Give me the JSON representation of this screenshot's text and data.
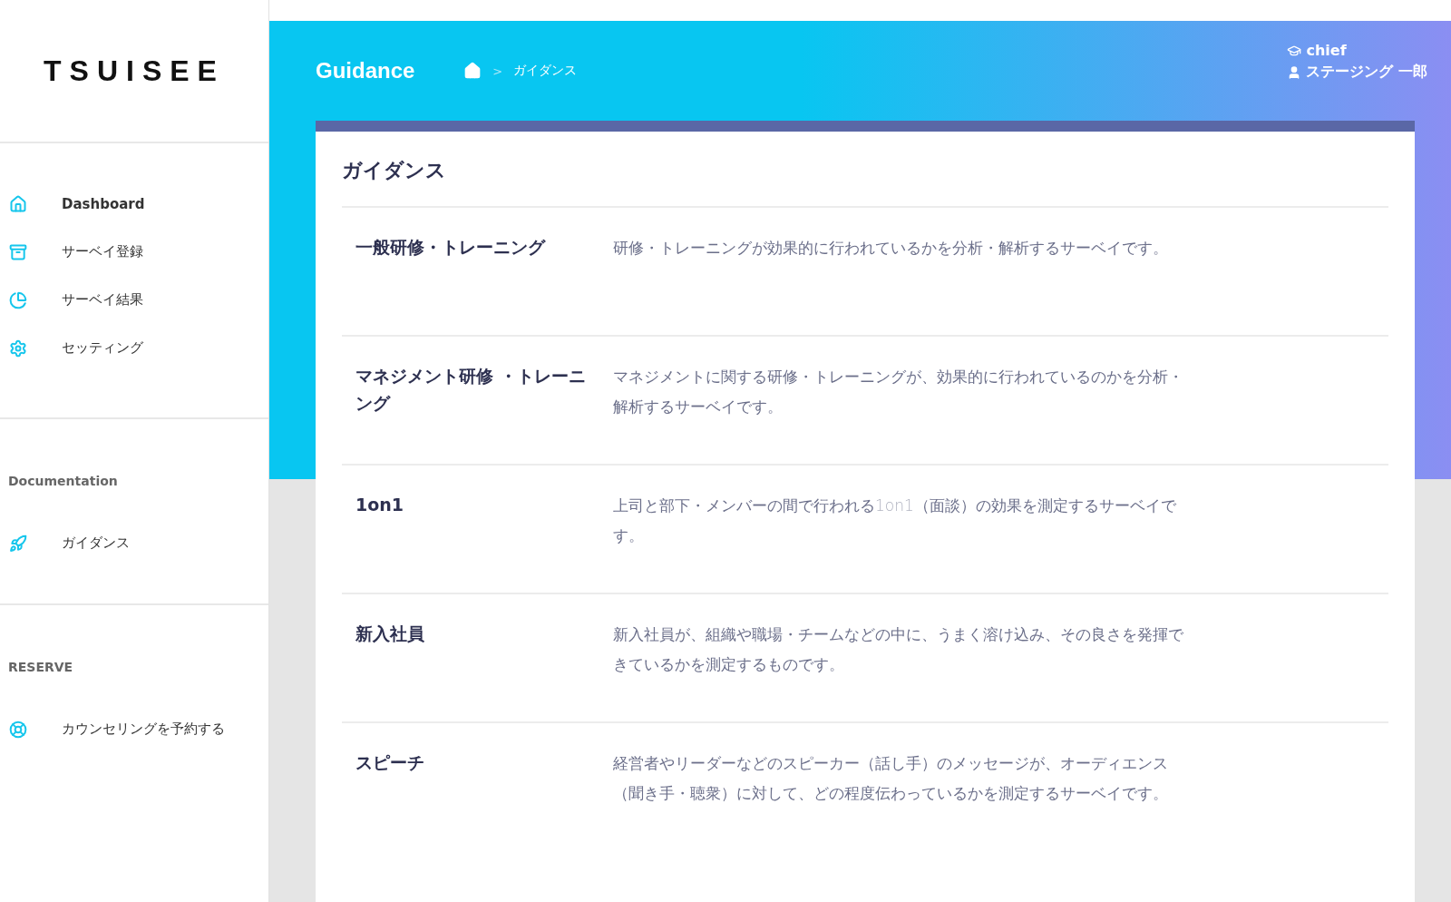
{
  "sidebar": {
    "logo": "TSUISEE",
    "sections": [
      {
        "items": [
          {
            "label": "Dashboard",
            "kind": "home",
            "selected": true
          },
          {
            "label": "サーベイ登録",
            "kind": "archive",
            "selected": false
          },
          {
            "label": "サーベイ結果",
            "kind": "chart",
            "selected": false
          },
          {
            "label": "セッティング",
            "kind": "settings",
            "selected": false
          }
        ]
      },
      {
        "heading": "Documentation",
        "items": [
          {
            "label": "ガイダンス",
            "kind": "rocket",
            "selected": false
          }
        ]
      },
      {
        "heading": "RESERVE",
        "items": [
          {
            "label": "カウンセリングを予約する",
            "kind": "support",
            "selected": false
          }
        ]
      }
    ]
  },
  "header": {
    "title": "Guidance",
    "breadcrumb": [
      {
        "kind": "home"
      },
      {
        "kind": "text",
        "label": "ガイダンス"
      }
    ],
    "separator": ">",
    "role": "chief",
    "user": "ステージング 一郎"
  },
  "card": {
    "title": "ガイダンス",
    "rows": [
      {
        "term": "一般研修・トレーニング",
        "description": [
          {
            "kind": "normal",
            "text": "研修・トレーニングが効果的に行われているかを分析・解析するサーベイです。"
          }
        ]
      },
      {
        "term": "マネジメント研修 ・トレーニング",
        "description": [
          {
            "kind": "normal",
            "text": "マネジメントに関する研修・トレーニングが、効果的に行われているのかを分析・解析するサーベイです。"
          }
        ]
      },
      {
        "term": "1on1",
        "description": [
          {
            "kind": "normal",
            "text": "上司と部下・メンバーの間で行われる"
          },
          {
            "kind": "light",
            "text": "1on1"
          },
          {
            "kind": "normal",
            "text": "（面談）の効果を測定するサーベイです。"
          }
        ]
      },
      {
        "term": "新入社員",
        "description": [
          {
            "kind": "normal",
            "text": "新入社員が、組織や職場・チームなどの中に、うまく溶け込み、その良さを発揮できているかを測定するものです。"
          }
        ]
      },
      {
        "term": "スピーチ",
        "description": [
          {
            "kind": "normal",
            "text": "経営者やリーダーなどのスピーカー（話し手）のメッセージが、オーディエンス（聞き手・聴衆）に対して、どの程度伝わっているかを測定するサーベイです。"
          }
        ]
      }
    ]
  }
}
